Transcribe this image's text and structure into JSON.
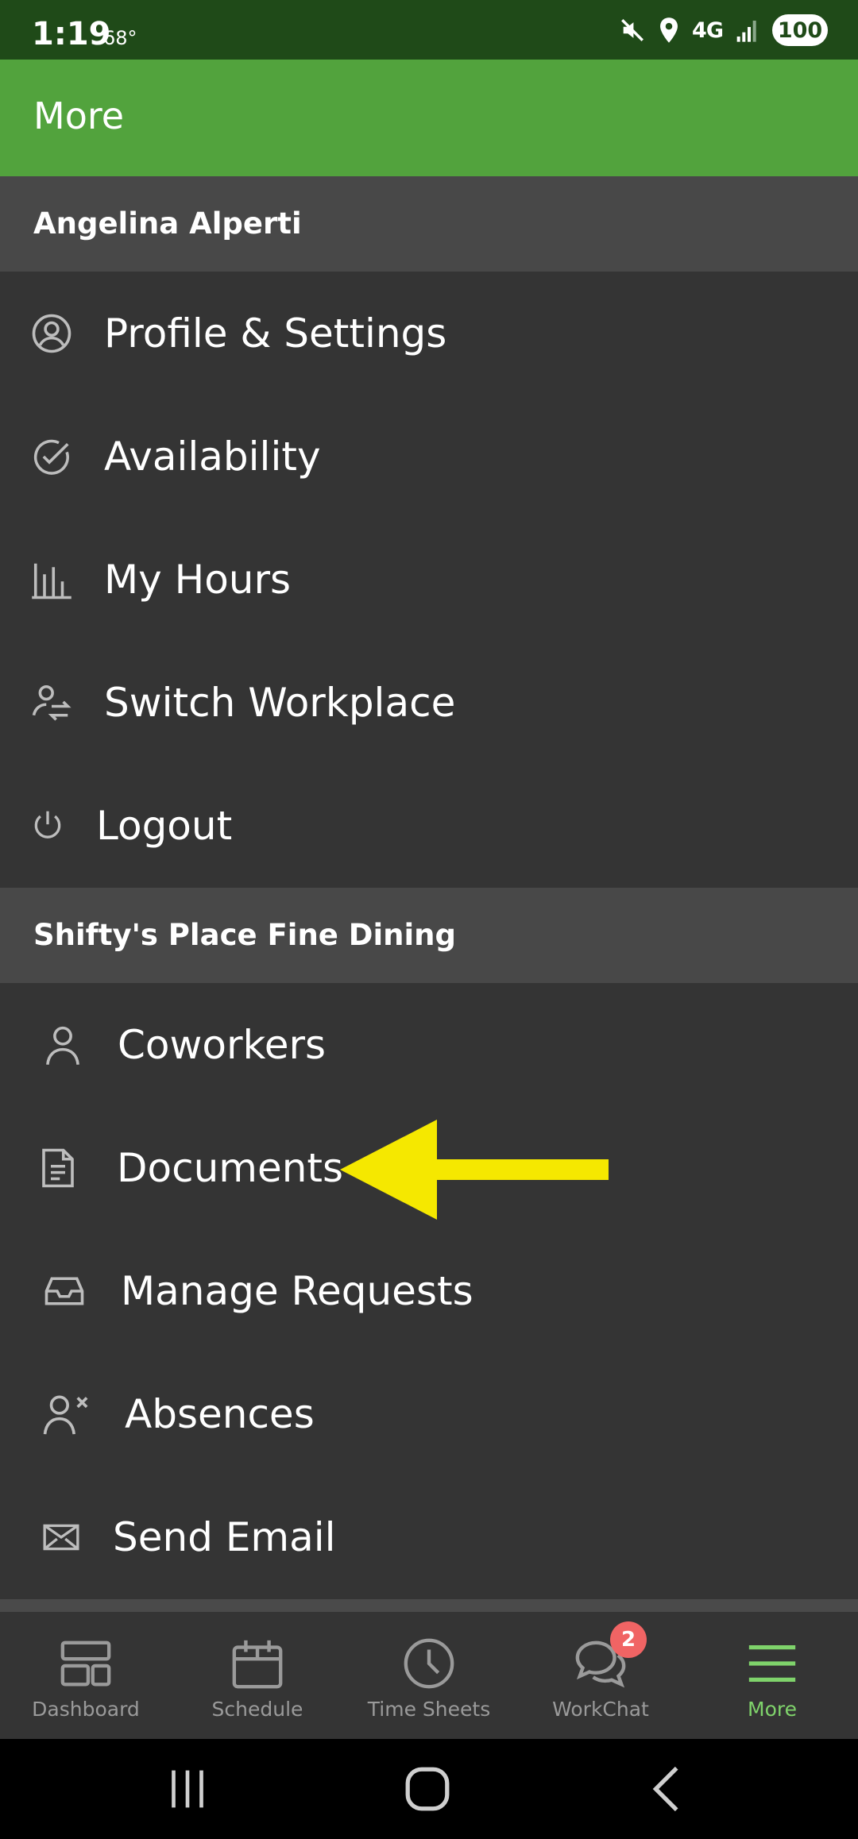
{
  "status_bar": {
    "time": "1:19",
    "temperature": "68°",
    "network": "4G",
    "battery": "100",
    "icons": [
      "mute-icon",
      "location-icon",
      "signal-icon"
    ]
  },
  "header": {
    "title": "More"
  },
  "sections": [
    {
      "title": "Angelina Alperti",
      "items": [
        {
          "label": "Profile & Settings",
          "icon": "user-circle-icon"
        },
        {
          "label": "Availability",
          "icon": "check-circle-icon"
        },
        {
          "label": "My Hours",
          "icon": "bar-chart-icon"
        },
        {
          "label": "Switch Workplace",
          "icon": "user-switch-icon"
        },
        {
          "label": "Logout",
          "icon": "power-icon"
        }
      ]
    },
    {
      "title": "Shifty's Place Fine Dining",
      "items": [
        {
          "label": "Coworkers",
          "icon": "person-icon"
        },
        {
          "label": "Documents",
          "icon": "document-icon"
        },
        {
          "label": "Manage Requests",
          "icon": "inbox-icon"
        },
        {
          "label": "Absences",
          "icon": "person-remove-icon"
        },
        {
          "label": "Send Email",
          "icon": "envelope-icon"
        }
      ]
    }
  ],
  "tabs": [
    {
      "label": "Dashboard",
      "icon": "dashboard-icon",
      "active": false
    },
    {
      "label": "Schedule",
      "icon": "calendar-icon",
      "active": false
    },
    {
      "label": "Time Sheets",
      "icon": "clock-icon",
      "active": false
    },
    {
      "label": "WorkChat",
      "icon": "chat-icon",
      "active": false,
      "badge": "2"
    },
    {
      "label": "More",
      "icon": "menu-icon",
      "active": true
    }
  ],
  "colors": {
    "status_bar": "#1f4a18",
    "header": "#52a33d",
    "background": "#343434",
    "section_header": "#484848",
    "active_tab": "#7fd36b",
    "badge": "#f06464",
    "annotation_arrow": "#f5e800"
  }
}
